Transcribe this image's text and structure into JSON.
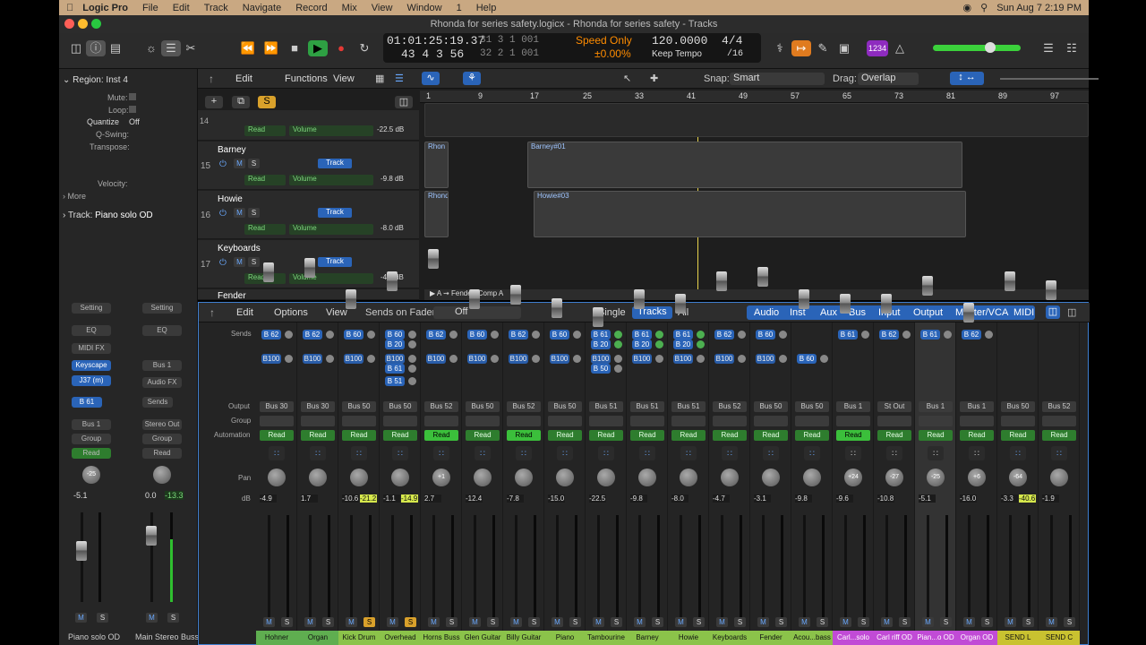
{
  "menubar": {
    "app": "Logic Pro",
    "items": [
      "File",
      "Edit",
      "Track",
      "Navigate",
      "Record",
      "Mix",
      "View",
      "Window",
      "1",
      "Help"
    ],
    "clock": "Sun Aug 7  2:19 PM"
  },
  "window": {
    "title": "Rhonda for series safety.logicx - Rhonda for series safety - Tracks"
  },
  "lcd": {
    "position": "01:01:25:19.37",
    "bars_top": "31  3  1  001",
    "bars_beats": "43  4  3     56",
    "bars_bottom": "32  2  1  001",
    "mode": "Speed Only",
    "percent": "±0.00%",
    "tempo": "120.0000",
    "tempo_mode": "Keep Tempo",
    "sig": "4/4",
    "div": "/16"
  },
  "toolbar": {
    "badge": "1234"
  },
  "inspector": {
    "region_title": "Region: Inst 4",
    "mute": "Mute:",
    "loop": "Loop:",
    "quantize": "Quantize",
    "quantize_val": "Off",
    "qswing": "Q-Swing:",
    "transpose": "Transpose:",
    "velocity": "Velocity:",
    "more": "More",
    "track": "Track:",
    "track_name": "Piano solo OD",
    "strip1": {
      "setting": "Setting",
      "eq": "EQ",
      "midifx": "MIDI FX",
      "inst": "Keyscape",
      "plugin": "J37 (m)",
      "send": "B 61",
      "out": "Bus 1",
      "group": "Group",
      "auto": "Read",
      "pan": "-25",
      "db": "-5.1",
      "name": "Piano solo OD"
    },
    "strip2": {
      "setting": "Setting",
      "eq": "EQ",
      "bus": "Bus 1",
      "audiofx": "Audio FX",
      "sends": "Sends",
      "out": "Stereo Out",
      "group": "Group",
      "auto": "Read",
      "db": "0.0",
      "peak": "-13.3",
      "name": "Main Stereo Buss"
    }
  },
  "tracks": {
    "menus": [
      "Edit",
      "Functions",
      "View"
    ],
    "snap_label": "Snap:",
    "snap": "Smart",
    "drag_label": "Drag:",
    "drag": "Overlap",
    "ruler": [
      "1",
      "9",
      "17",
      "25",
      "33",
      "41",
      "49",
      "57",
      "65",
      "73",
      "81",
      "89",
      "97"
    ],
    "rows": [
      {
        "num": "14",
        "name": "",
        "auto": "Read",
        "param": "Volume",
        "val": "-22.5 dB"
      },
      {
        "num": "15",
        "name": "Barney",
        "auto": "Read",
        "param": "Volume",
        "val": "-9.8 dB"
      },
      {
        "num": "16",
        "name": "Howie",
        "auto": "Read",
        "param": "Volume",
        "val": "-8.0 dB"
      },
      {
        "num": "17",
        "name": "Keyboards",
        "auto": "Read",
        "param": "Volume",
        "val": "-4.7 dB"
      },
      {
        "num": "",
        "name": "Fender"
      }
    ],
    "regions": [
      "Rhon",
      "Barney#01",
      "Rhond",
      "Howie#03"
    ],
    "footer": "Fender: Comp A"
  },
  "mixer": {
    "menus": [
      "Edit",
      "Options",
      "View"
    ],
    "sends_on_faders": "Sends on Faders:",
    "sof_val": "Off",
    "modes": [
      "Single",
      "Tracks",
      "All"
    ],
    "filters": [
      "Audio",
      "Inst",
      "Aux",
      "Bus",
      "Input",
      "Output",
      "Master/VCA",
      "MIDI"
    ],
    "row_labels": [
      "Sends",
      "Output",
      "Group",
      "Automation",
      "Pan",
      "dB"
    ],
    "channels": [
      {
        "name": "Hohner",
        "sends": [
          "B 62",
          "B100"
        ],
        "out": "Bus 30",
        "auto": "Read",
        "pan": "",
        "db": "-4.9",
        "peak": "",
        "color": "#5fae50"
      },
      {
        "name": "Organ",
        "sends": [
          "B 62",
          "B100"
        ],
        "out": "Bus 30",
        "auto": "Read",
        "pan": "",
        "db": "1.7",
        "peak": "",
        "color": "#5fae50"
      },
      {
        "name": "Kick Drum",
        "sends": [
          "B 60",
          "B100"
        ],
        "out": "Bus 50",
        "auto": "Read",
        "pan": "",
        "db": "-10.6",
        "peak": "-21.2",
        "color": "#8bc34a"
      },
      {
        "name": "Overhead",
        "sends": [
          "B 60",
          "B 20",
          "B100",
          "B 61",
          "B 51"
        ],
        "out": "Bus 50",
        "auto": "Read",
        "pan": "",
        "db": "-1.1",
        "peak": "-14.9",
        "color": "#8bc34a"
      },
      {
        "name": "Horns Buss",
        "sends": [
          "B 62",
          "B100"
        ],
        "out": "Bus 52",
        "auto": "Read",
        "pan": "+1",
        "db": "2.7",
        "peak": "",
        "color": "#8bc34a"
      },
      {
        "name": "Glen Guitar",
        "sends": [
          "B 60",
          "B100"
        ],
        "out": "Bus 50",
        "auto": "Read",
        "pan": "",
        "db": "-12.4",
        "peak": "",
        "color": "#8bc34a"
      },
      {
        "name": "Billy Guitar",
        "sends": [
          "B 62",
          "B100"
        ],
        "out": "Bus 52",
        "auto": "Read",
        "pan": "",
        "db": "-7.8",
        "peak": "",
        "color": "#8bc34a"
      },
      {
        "name": "Piano",
        "sends": [
          "B 60",
          "B100"
        ],
        "out": "Bus 50",
        "auto": "Read",
        "pan": "",
        "db": "-15.0",
        "peak": "",
        "color": "#8bc34a"
      },
      {
        "name": "Tambourine",
        "sends": [
          "B 61",
          "B 20",
          "B100",
          "B 50"
        ],
        "out": "Bus 51",
        "auto": "Read",
        "pan": "",
        "db": "-22.5",
        "peak": "",
        "color": "#8bc34a"
      },
      {
        "name": "Barney",
        "sends": [
          "B 61",
          "B 20",
          "B100"
        ],
        "out": "Bus 51",
        "auto": "Read",
        "pan": "",
        "db": "-9.8",
        "peak": "",
        "color": "#8bc34a"
      },
      {
        "name": "Howie",
        "sends": [
          "B 61",
          "B 20",
          "B100"
        ],
        "out": "Bus 51",
        "auto": "Read",
        "pan": "",
        "db": "-8.0",
        "peak": "",
        "color": "#8bc34a"
      },
      {
        "name": "Keyboards",
        "sends": [
          "B 62",
          "B100"
        ],
        "out": "Bus 52",
        "auto": "Read",
        "pan": "",
        "db": "-4.7",
        "peak": "",
        "color": "#8bc34a"
      },
      {
        "name": "Fender",
        "sends": [
          "B 60",
          "B100"
        ],
        "out": "Bus 50",
        "auto": "Read",
        "pan": "",
        "db": "-3.1",
        "peak": "",
        "color": "#8bc34a"
      },
      {
        "name": "Acou...bass",
        "sends": [
          "",
          "B 60"
        ],
        "out": "Bus 50",
        "auto": "Read",
        "pan": "",
        "db": "-9.8",
        "peak": "",
        "color": "#8bc34a"
      },
      {
        "name": "Carl...solo",
        "sends": [
          "B 61"
        ],
        "out": "Bus 1",
        "auto": "Read",
        "pan": "+24",
        "db": "-9.6",
        "peak": "",
        "color": "#c14bd6"
      },
      {
        "name": "Carl riff OD",
        "sends": [
          "B 62"
        ],
        "out": "St Out",
        "auto": "Read",
        "pan": "-27",
        "db": "-10.8",
        "peak": "",
        "color": "#c14bd6"
      },
      {
        "name": "Pian...o OD",
        "sends": [
          "B 61"
        ],
        "out": "Bus 1",
        "auto": "Read",
        "pan": "-25",
        "db": "-5.1",
        "peak": "",
        "color": "#c14bd6"
      },
      {
        "name": "Organ OD",
        "sends": [
          "B 62"
        ],
        "out": "Bus 1",
        "auto": "Read",
        "pan": "+6",
        "db": "-16.0",
        "peak": "",
        "color": "#c14bd6"
      },
      {
        "name": "SEND L",
        "sends": [],
        "out": "Bus 50",
        "auto": "Read",
        "pan": "-64",
        "db": "-3.3",
        "peak": "-40.6",
        "color": "#c9c230"
      },
      {
        "name": "SEND C",
        "sends": [],
        "out": "Bus 52",
        "auto": "Read",
        "pan": "",
        "db": "-1.9",
        "peak": "",
        "color": "#c9c230"
      }
    ]
  }
}
